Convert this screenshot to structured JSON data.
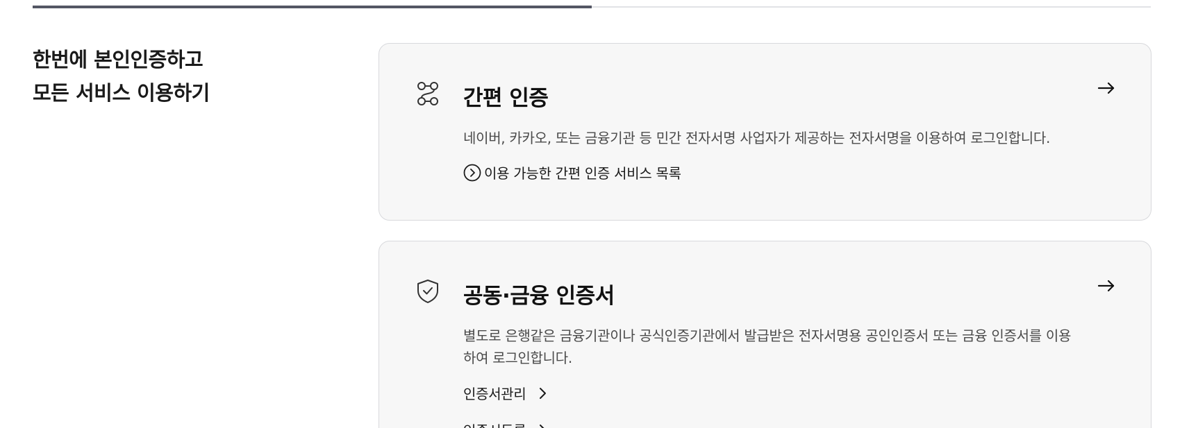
{
  "progress": {
    "fraction": 0.5
  },
  "headline": {
    "line1": "한번에 본인인증하고",
    "line2": "모든 서비스 이용하기"
  },
  "cards": [
    {
      "icon": "route-nodes-icon",
      "title": "간편 인증",
      "description": "네이버, 카카오, 또는 금융기관 등 민간 전자서명 사업자가 제공하는 전자서명을 이용하여 로그인합니다.",
      "link": "이용 가능한 간편 인증 서비스 목록",
      "arrow": "right-arrow-icon"
    },
    {
      "icon": "shield-check-icon",
      "title": "공동·금융 인증서",
      "description": "별도로 은행같은 금융기관이나 공식인증기관에서 발급받은 전자서명용 공인인증서 또는 금융 인증서를 이용하여 로그인합니다.",
      "links": [
        "인증서관리",
        "인증서등록"
      ],
      "arrow": "right-arrow-icon"
    }
  ]
}
